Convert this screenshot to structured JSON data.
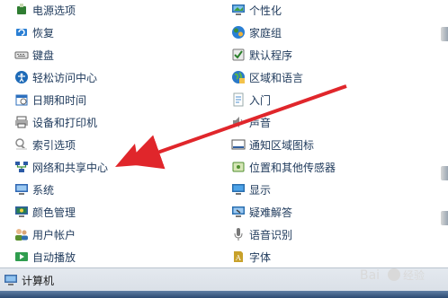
{
  "items_left": [
    {
      "label": "电源选项",
      "icon": "power-options-icon",
      "color": "#2f7d32"
    },
    {
      "label": "恢复",
      "icon": "recovery-icon",
      "color": "#2a7fd4"
    },
    {
      "label": "键盘",
      "icon": "keyboard-icon",
      "color": "#666666"
    },
    {
      "label": "轻松访问中心",
      "icon": "ease-of-access-icon",
      "color": "#1f6bb8"
    },
    {
      "label": "日期和时间",
      "icon": "date-time-icon",
      "color": "#2c6fbe"
    },
    {
      "label": "设备和打印机",
      "icon": "devices-printers-icon",
      "color": "#555555"
    },
    {
      "label": "索引选项",
      "icon": "indexing-options-icon",
      "color": "#8a8a8a"
    },
    {
      "label": "网络和共享中心",
      "icon": "network-sharing-center-icon",
      "color": "#2b5aa6"
    },
    {
      "label": "系统",
      "icon": "system-icon",
      "color": "#2f67b3"
    },
    {
      "label": "颜色管理",
      "icon": "color-management-icon",
      "color": "#2a7f4f"
    },
    {
      "label": "用户帐户",
      "icon": "user-accounts-icon",
      "color": "#5a8f2f"
    },
    {
      "label": "自动播放",
      "icon": "autoplay-icon",
      "color": "#2f9d4e"
    }
  ],
  "items_right": [
    {
      "label": "个性化",
      "icon": "personalization-icon",
      "color": "#2a6fb0"
    },
    {
      "label": "家庭组",
      "icon": "homegroup-icon",
      "color": "#3b8f3a"
    },
    {
      "label": "默认程序",
      "icon": "default-programs-icon",
      "color": "#2a7f2a"
    },
    {
      "label": "区域和语言",
      "icon": "region-language-icon",
      "color": "#2b79c8"
    },
    {
      "label": "入门",
      "icon": "getting-started-icon",
      "color": "#4b8fcf"
    },
    {
      "label": "声音",
      "icon": "sound-icon",
      "color": "#888888"
    },
    {
      "label": "通知区域图标",
      "icon": "notification-area-icon",
      "color": "#555555"
    },
    {
      "label": "位置和其他传感器",
      "icon": "location-sensors-icon",
      "color": "#4f8f2f"
    },
    {
      "label": "显示",
      "icon": "display-icon",
      "color": "#2a6fb0"
    },
    {
      "label": "疑难解答",
      "icon": "troubleshooting-icon",
      "color": "#2a6fb0"
    },
    {
      "label": "语音识别",
      "icon": "speech-recognition-icon",
      "color": "#777777"
    },
    {
      "label": "字体",
      "icon": "fonts-icon",
      "color": "#c8a12a"
    }
  ],
  "bottom": {
    "label": "计算机",
    "icon": "computer-icon"
  },
  "annotation": {
    "arrow_color": "#e0262b"
  },
  "watermark_text": "Bai 经验"
}
